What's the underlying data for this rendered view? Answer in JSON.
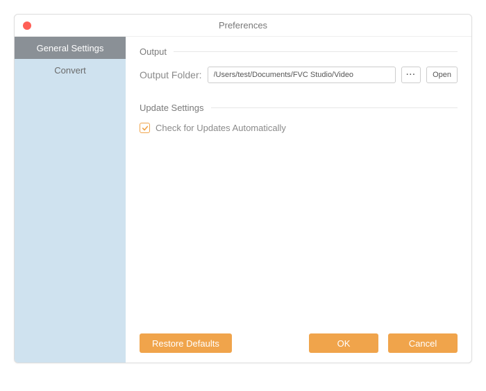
{
  "window": {
    "title": "Preferences"
  },
  "sidebar": {
    "items": [
      {
        "label": "General Settings",
        "active": true
      },
      {
        "label": "Convert",
        "active": false
      }
    ]
  },
  "sections": {
    "output": {
      "title": "Output",
      "folder_label": "Output Folder:",
      "folder_value": "/Users/test/Documents/FVC Studio/Video",
      "browse_label": "···",
      "open_label": "Open"
    },
    "update": {
      "title": "Update Settings",
      "check_auto_label": "Check for Updates Automatically",
      "check_auto_checked": true
    }
  },
  "footer": {
    "restore_label": "Restore Defaults",
    "ok_label": "OK",
    "cancel_label": "Cancel"
  },
  "colors": {
    "accent": "#f0a44b",
    "sidebar_bg": "#cfe2ef",
    "sidebar_active": "#8a9096"
  }
}
